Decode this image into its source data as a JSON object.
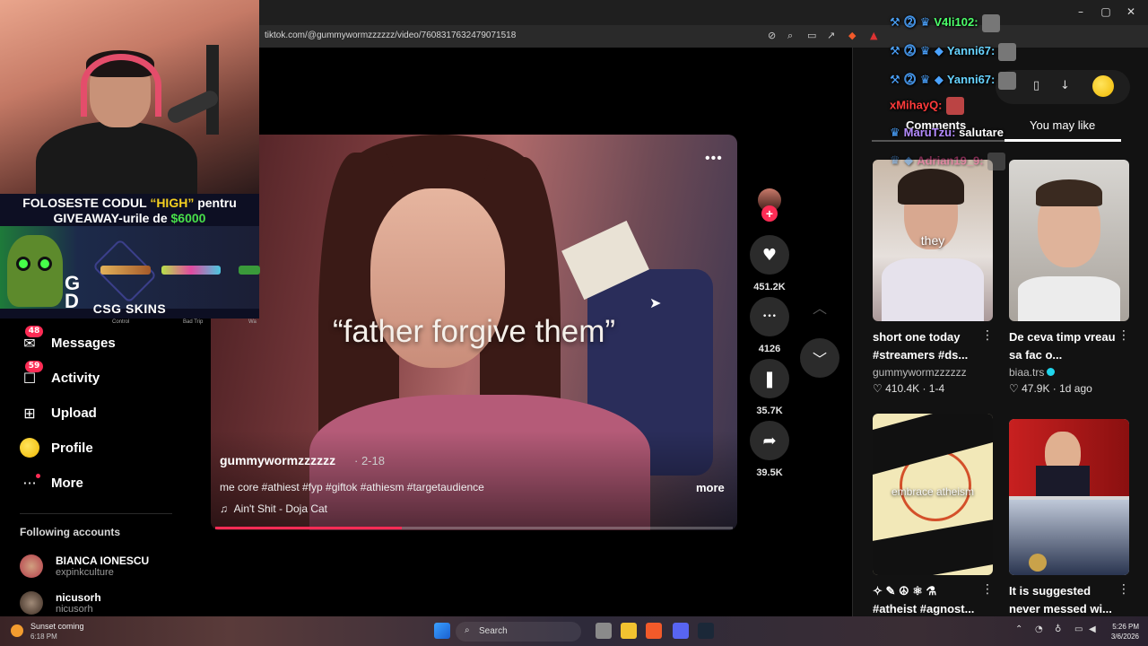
{
  "browser": {
    "url": "tiktok.com/@gummywormzzzzzz/video/7608317632479071518",
    "window_controls": [
      "–",
      "▢",
      "✕"
    ]
  },
  "promo": {
    "line1_a": "FOLOSESTE CODUL ",
    "line1_code": "“HIGH”",
    "line1_b": " pentru",
    "line2_a": "GIVEAWAY-urile de ",
    "line2_amount": "$6000",
    "skin_labels": [
      "Control",
      "Bad Trip",
      "Wa"
    ],
    "brand": "CSG SKINS"
  },
  "nav": {
    "items": [
      {
        "label": "Messages",
        "icon": "messages-icon",
        "glyph": "✉",
        "badge": "48"
      },
      {
        "label": "Activity",
        "icon": "activity-icon",
        "glyph": "☐",
        "badge": "59"
      },
      {
        "label": "Upload",
        "icon": "upload-icon",
        "glyph": "⊞",
        "badge": ""
      },
      {
        "label": "Profile",
        "icon": "profile-icon",
        "glyph": "",
        "badge": ""
      },
      {
        "label": "More",
        "icon": "more-icon",
        "glyph": "···",
        "badge": ""
      }
    ],
    "following_header": "Following accounts",
    "following": [
      {
        "name": "BIANCA IONESCU",
        "username": "expinkculture",
        "color": "#b43c4a"
      },
      {
        "name": "nicusorh",
        "username": "nicusorh",
        "color": "#5a4a3a"
      }
    ]
  },
  "video": {
    "caption_overlay": "“father forgive them”",
    "author": "gummywormzzzzzz",
    "date": " · 2-18",
    "description": "me core #athiest #fyp #giftok #athiesm #targetaudience",
    "more": "more",
    "music_icon": "♫",
    "music": "Ain't Shit - Doja Cat",
    "progress": 0.36
  },
  "actions": [
    {
      "name": "like",
      "icon": "heart-icon",
      "glyph": "♥",
      "count": "451.2K"
    },
    {
      "name": "comment",
      "icon": "comment-icon",
      "glyph": "•••",
      "count": "4126"
    },
    {
      "name": "bookmark",
      "icon": "bookmark-icon",
      "glyph": "❚",
      "count": "35.7K"
    },
    {
      "name": "share",
      "icon": "share-icon",
      "glyph": "➦",
      "count": "39.5K"
    }
  ],
  "side_tabs": {
    "comments": "Comments",
    "you_may_like": "You may like"
  },
  "cards": [
    {
      "title": "short one today #streamers #ds...",
      "user": "gummywormzzzzzz",
      "stats": "♡ 410.4K · 1-4",
      "overlay": "they",
      "verified": false
    },
    {
      "title": "De ceva timp vreau sa fac o...",
      "user": "biaa.trs",
      "stats": "♡ 47.9K · 1d ago",
      "overlay": "",
      "verified": true
    },
    {
      "title": "✧ ✎ ☮ ⚛ ⚗ #atheist #agnost...",
      "user": "",
      "stats": "",
      "overlay": "embrace atheism",
      "verified": false
    },
    {
      "title": "It is suggested never messed wi...",
      "user": "",
      "stats": "",
      "overlay": "",
      "verified": false
    }
  ],
  "chat": [
    {
      "user": "V4li102:",
      "msg": "",
      "color": "#4cff6a"
    },
    {
      "user": "Yanni67:",
      "msg": "",
      "color": "#67d3ff"
    },
    {
      "user": "Yanni67:",
      "msg": "",
      "color": "#67d3ff"
    },
    {
      "user": "xMihayQ:",
      "msg": "",
      "color": "#ff3b3b"
    },
    {
      "user": "MaruTzu:",
      "msg": "salutare",
      "color": "#b48bff"
    },
    {
      "user": "Adrian19_9:",
      "msg": "",
      "color": "#ff4b9b"
    }
  ],
  "taskbar": {
    "weather_title": "Sunset coming",
    "weather_time": "6:18 PM",
    "search": "Search",
    "time": "5:26 PM",
    "date": "3/6/2026"
  }
}
